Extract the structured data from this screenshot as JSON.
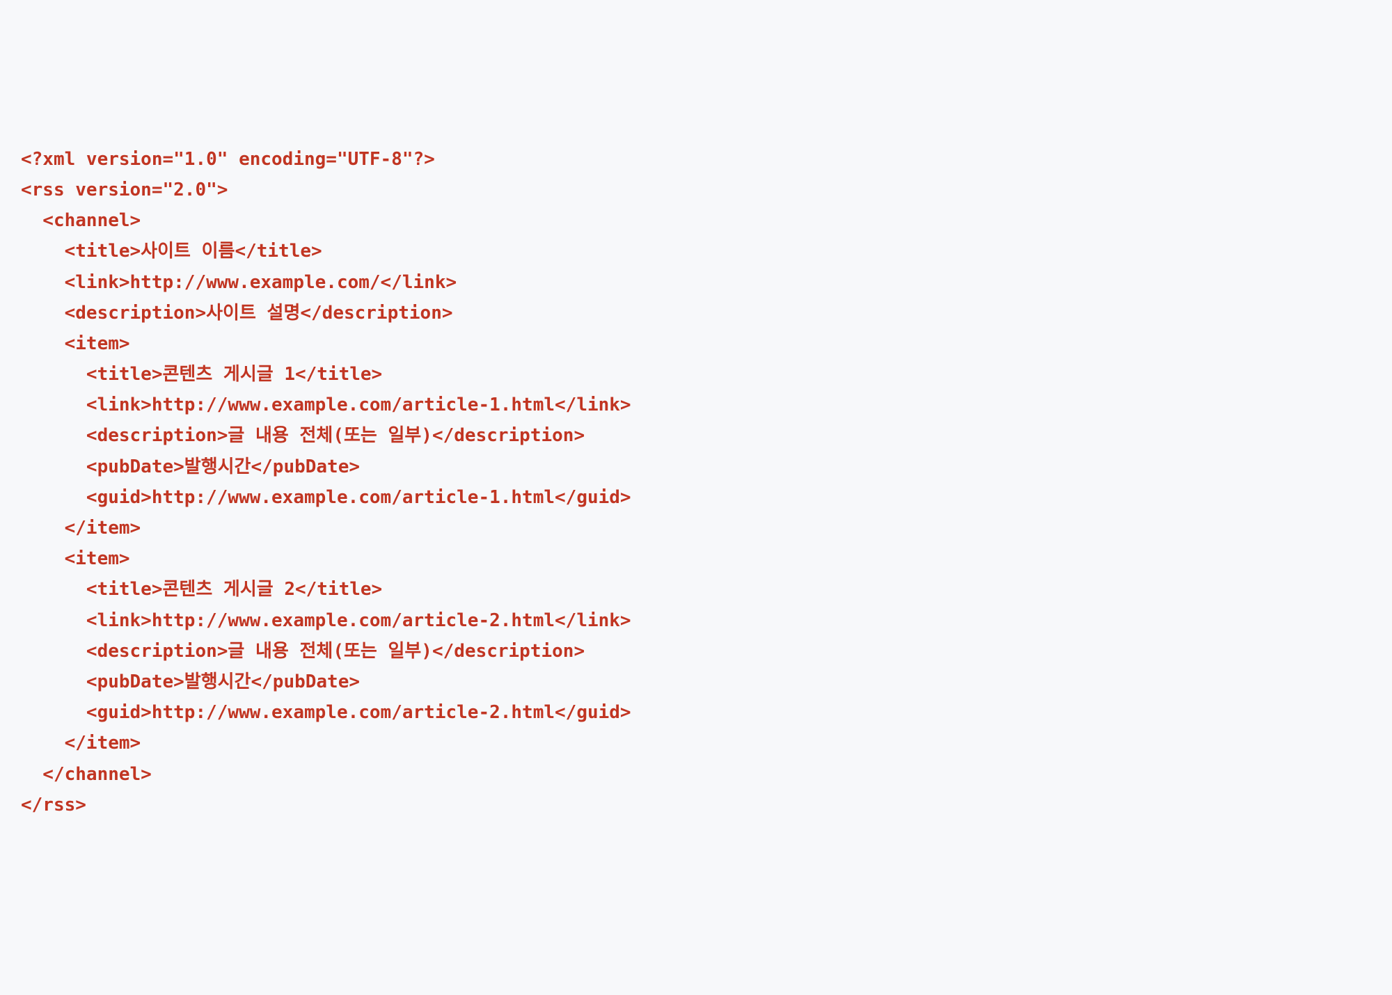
{
  "code": {
    "lines": [
      "<?xml version=\"1.0\" encoding=\"UTF-8\"?>",
      "<rss version=\"2.0\">",
      "  <channel>",
      "    <title>사이트 이름</title>",
      "    <link>http://www.example.com/</link>",
      "    <description>사이트 설명</description>",
      "    <item>",
      "      <title>콘텐츠 게시글 1</title>",
      "      <link>http://www.example.com/article-1.html</link>",
      "      <description>글 내용 전체(또는 일부)</description>",
      "      <pubDate>발행시간</pubDate>",
      "      <guid>http://www.example.com/article-1.html</guid>",
      "    </item>",
      "    <item>",
      "      <title>콘텐츠 게시글 2</title>",
      "      <link>http://www.example.com/article-2.html</link>",
      "      <description>글 내용 전체(또는 일부)</description>",
      "      <pubDate>발행시간</pubDate>",
      "      <guid>http://www.example.com/article-2.html</guid>",
      "    </item>",
      "  </channel>",
      "</rss>"
    ]
  }
}
